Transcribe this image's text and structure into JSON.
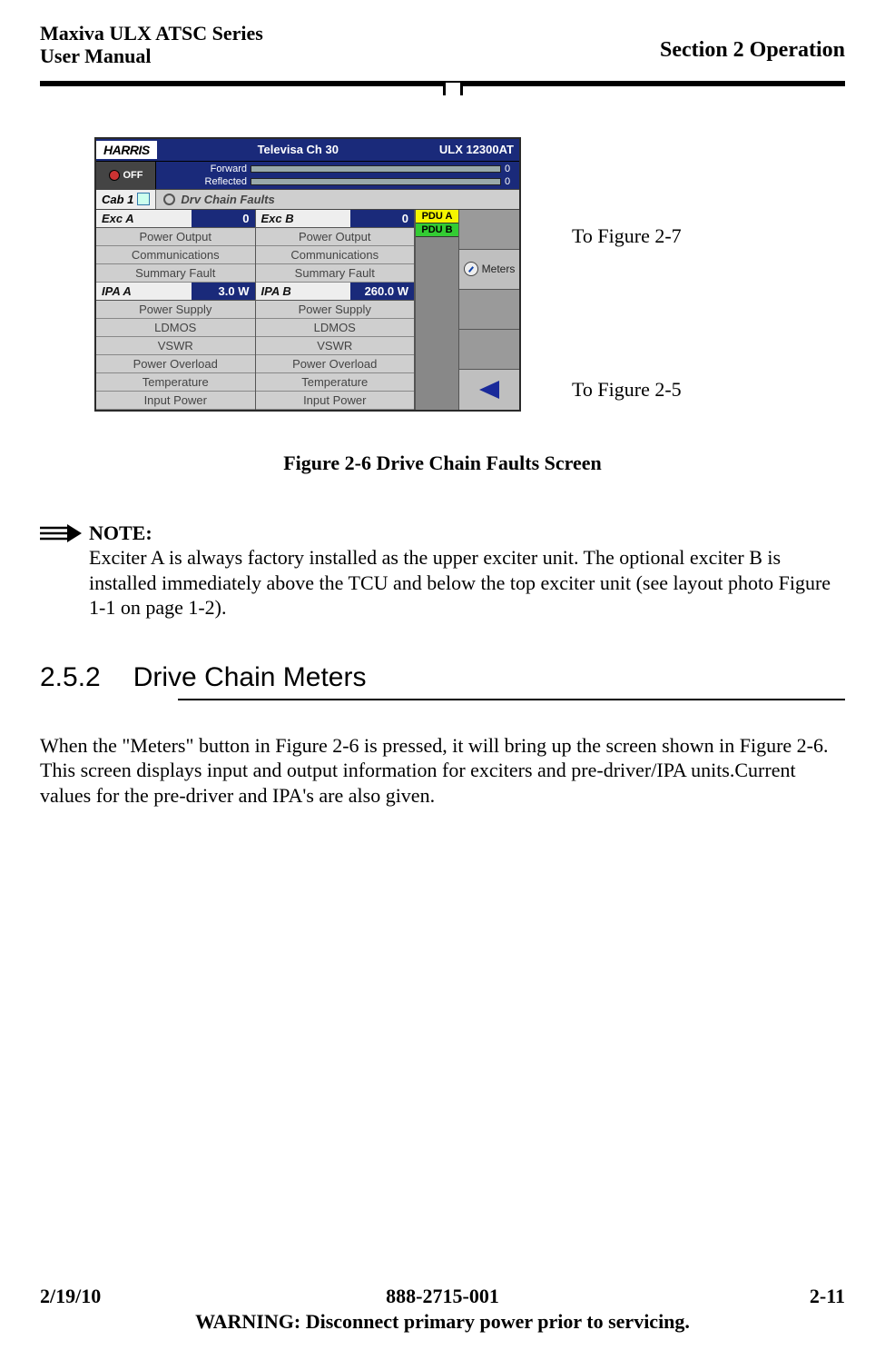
{
  "header": {
    "product": "Maxiva ULX ATSC Series",
    "subtitle": "User Manual",
    "section": "Section 2 Operation"
  },
  "screenshot": {
    "brand_logo_text": "HARRIS",
    "channel": "Televisa Ch 30",
    "model": "ULX 12300AT",
    "off_label": "OFF",
    "bar_forward_label": "Forward",
    "bar_reflected_label": "Reflected",
    "bar_forward_value": "0",
    "bar_reflected_value": "0",
    "cab_tab": "Cab 1",
    "breadcrumb": "Drv Chain Faults",
    "exc_a": {
      "title": "Exc A",
      "value": "0",
      "rows": [
        "Power Output",
        "Communications",
        "Summary Fault"
      ]
    },
    "exc_b": {
      "title": "Exc B",
      "value": "0",
      "rows": [
        "Power Output",
        "Communications",
        "Summary Fault"
      ]
    },
    "ipa_a": {
      "title": "IPA A",
      "value": "3.0 W",
      "rows": [
        "Power Supply",
        "LDMOS",
        "VSWR",
        "Power Overload",
        "Temperature",
        "Input Power"
      ]
    },
    "ipa_b": {
      "title": "IPA B",
      "value": "260.0 W",
      "rows": [
        "Power Supply",
        "LDMOS",
        "VSWR",
        "Power Overload",
        "Temperature",
        "Input Power"
      ]
    },
    "pdu_a": "PDU A",
    "pdu_b": "PDU B",
    "meters_btn": "Meters"
  },
  "callouts": {
    "to_fig_27": "To Figure 2-7",
    "to_fig_25": "To Figure 2-5"
  },
  "figure_caption": "Figure 2-6  Drive Chain Faults Screen",
  "note": {
    "title": "NOTE:",
    "body": "Exciter A is always factory installed as the upper exciter unit. The optional exciter B is installed immediately above the TCU and  below the  top exciter unit (see layout photo Figure 1-1 on page 1-2)."
  },
  "subsection": {
    "number": "2.5.2",
    "title": "Drive Chain Meters"
  },
  "paragraph": "When the \"Meters\" button in Figure 2-6 is pressed, it will bring up the screen shown in Figure 2-6. This screen displays input and output information for exciters and pre-driver/IPA units.Current values for the pre-driver and IPA's are also given.",
  "footer": {
    "date": "2/19/10",
    "docnum": "888-2715-001",
    "pagenum": "2-11",
    "warning": "WARNING: Disconnect primary power prior to servicing."
  }
}
